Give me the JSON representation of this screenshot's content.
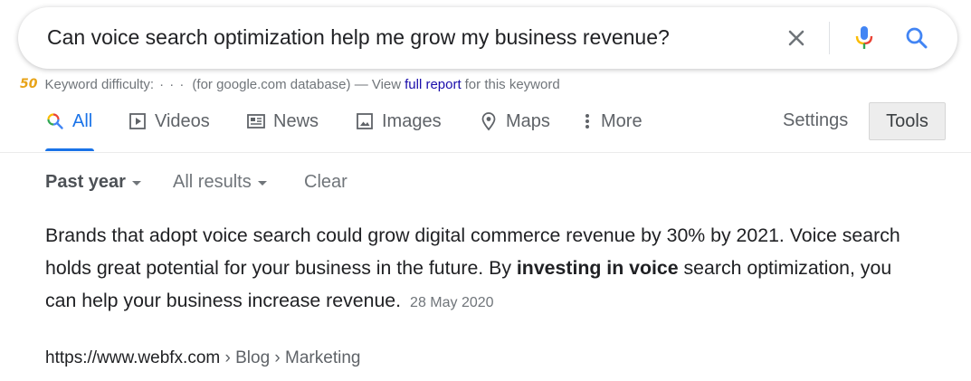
{
  "search": {
    "query": "Can voice search optimization help me grow my business revenue?"
  },
  "keyword_bar": {
    "logo": "50",
    "label": "Keyword difficulty:",
    "dots": "· · ·",
    "db_note": "(for google.com database) — View",
    "link": "full report",
    "suffix": "for this keyword"
  },
  "tabs": [
    {
      "label": "All",
      "icon": "search-icon",
      "active": true
    },
    {
      "label": "Videos",
      "icon": "play-icon"
    },
    {
      "label": "News",
      "icon": "news-icon"
    },
    {
      "label": "Images",
      "icon": "image-icon"
    },
    {
      "label": "Maps",
      "icon": "map-pin-icon"
    },
    {
      "label": "More",
      "icon": "more-vert-icon"
    }
  ],
  "settings_label": "Settings",
  "tools_label": "Tools",
  "filters": {
    "time": "Past year",
    "results": "All results",
    "clear": "Clear"
  },
  "snippet": {
    "text_before": "Brands that adopt voice search could grow digital commerce revenue by 30% by 2021. Voice search holds great potential for your business in the future. By ",
    "bold": "investing in voice",
    "text_after": " search optimization, you can help your business increase revenue.",
    "date": "28 May 2020"
  },
  "citation": {
    "url": "https://www.webfx.com",
    "breadcrumbs": " › Blog › Marketing"
  },
  "colors": {
    "accent": "#1a73e8",
    "link": "#1a0dab",
    "muted": "#70757a"
  }
}
